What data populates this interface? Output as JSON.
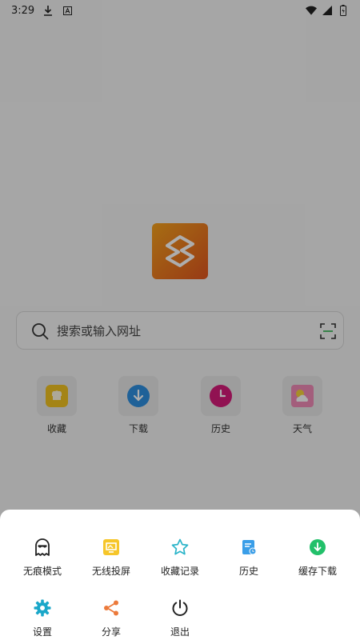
{
  "status_bar": {
    "time": "3:29",
    "icons": [
      "download-icon",
      "a-notification-icon",
      "wifi-icon",
      "signal-icon",
      "battery-icon"
    ]
  },
  "app": {
    "logo": "s-browser-logo-icon",
    "logo_colors": [
      "#f6a21d",
      "#e1561f"
    ]
  },
  "search": {
    "placeholder": "搜索或输入网址"
  },
  "shortcuts": [
    {
      "label": "收藏",
      "icon": "favorites-icon",
      "color": "#f2c321"
    },
    {
      "label": "下载",
      "icon": "download-icon",
      "color": "#2f8fe0"
    },
    {
      "label": "历史",
      "icon": "history-clock-icon",
      "color": "#d61b7a"
    },
    {
      "label": "天气",
      "icon": "weather-icon",
      "color": "#f08bb7"
    }
  ],
  "menu": {
    "items": [
      {
        "label": "无痕模式",
        "icon": "ghost-icon"
      },
      {
        "label": "无线投屏",
        "icon": "screen-cast-icon"
      },
      {
        "label": "收藏记录",
        "icon": "star-icon"
      },
      {
        "label": "历史",
        "icon": "history-icon"
      },
      {
        "label": "缓存下载",
        "icon": "cache-download-icon"
      },
      {
        "label": "设置",
        "icon": "settings-gear-icon"
      },
      {
        "label": "分享",
        "icon": "share-icon"
      },
      {
        "label": "退出",
        "icon": "power-icon"
      }
    ]
  }
}
